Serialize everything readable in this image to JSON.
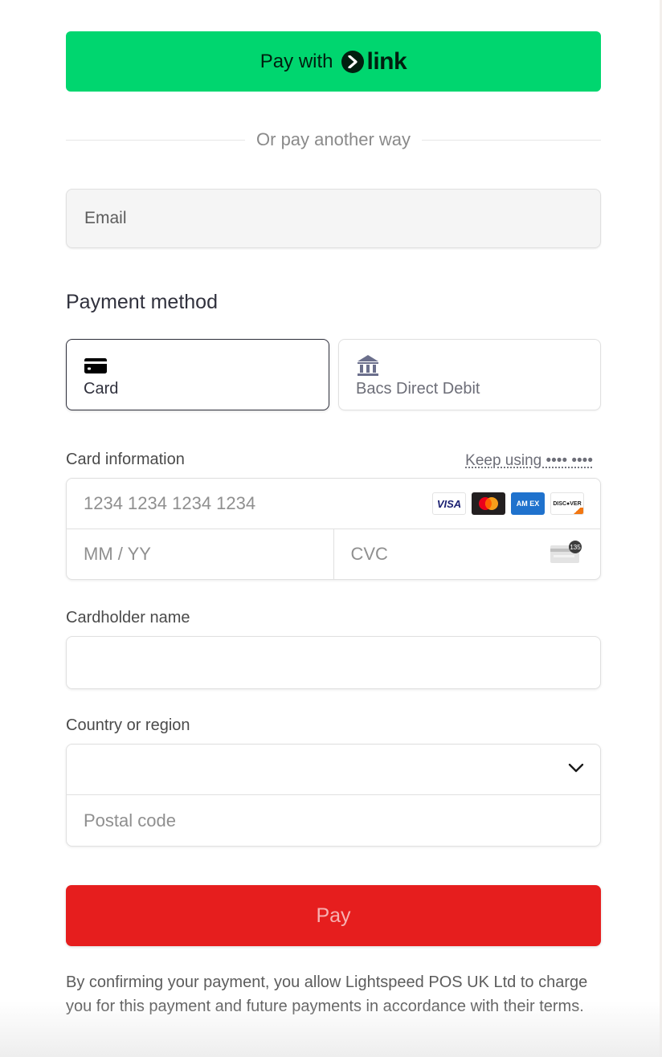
{
  "link_button": {
    "prefix": "Pay with",
    "brand": "link",
    "icon": "chevron-right-circle-icon",
    "color": "#00d66f"
  },
  "divider": {
    "text": "Or pay another way"
  },
  "email": {
    "placeholder": "Email",
    "value": ""
  },
  "payment_method": {
    "title": "Payment method",
    "tabs": [
      {
        "label": "Card",
        "icon": "credit-card-icon",
        "selected": true
      },
      {
        "label": "Bacs Direct Debit",
        "icon": "bank-icon",
        "selected": false
      }
    ]
  },
  "card_info": {
    "label": "Card information",
    "keep_using": "Keep using •••• ••••",
    "number_placeholder": "1234 1234 1234 1234",
    "expiry_placeholder": "MM / YY",
    "cvc_placeholder": "CVC",
    "cvc_icon_text": "135",
    "brands": [
      {
        "name": "visa",
        "text": "VISA"
      },
      {
        "name": "mastercard",
        "text": ""
      },
      {
        "name": "amex",
        "text": "AM EX"
      },
      {
        "name": "discover",
        "text": "DISC●VER"
      }
    ]
  },
  "cardholder": {
    "label": "Cardholder name",
    "value": "",
    "placeholder": ""
  },
  "country": {
    "label": "Country or region",
    "selected": "",
    "icon": "chevron-down-icon",
    "postal_placeholder": "Postal code"
  },
  "pay_button": {
    "label": "Pay",
    "color": "#e61e1e"
  },
  "terms": {
    "text": "By confirming your payment, you allow Lightspeed POS UK Ltd to charge you for this payment and future payments in accordance with their terms."
  }
}
